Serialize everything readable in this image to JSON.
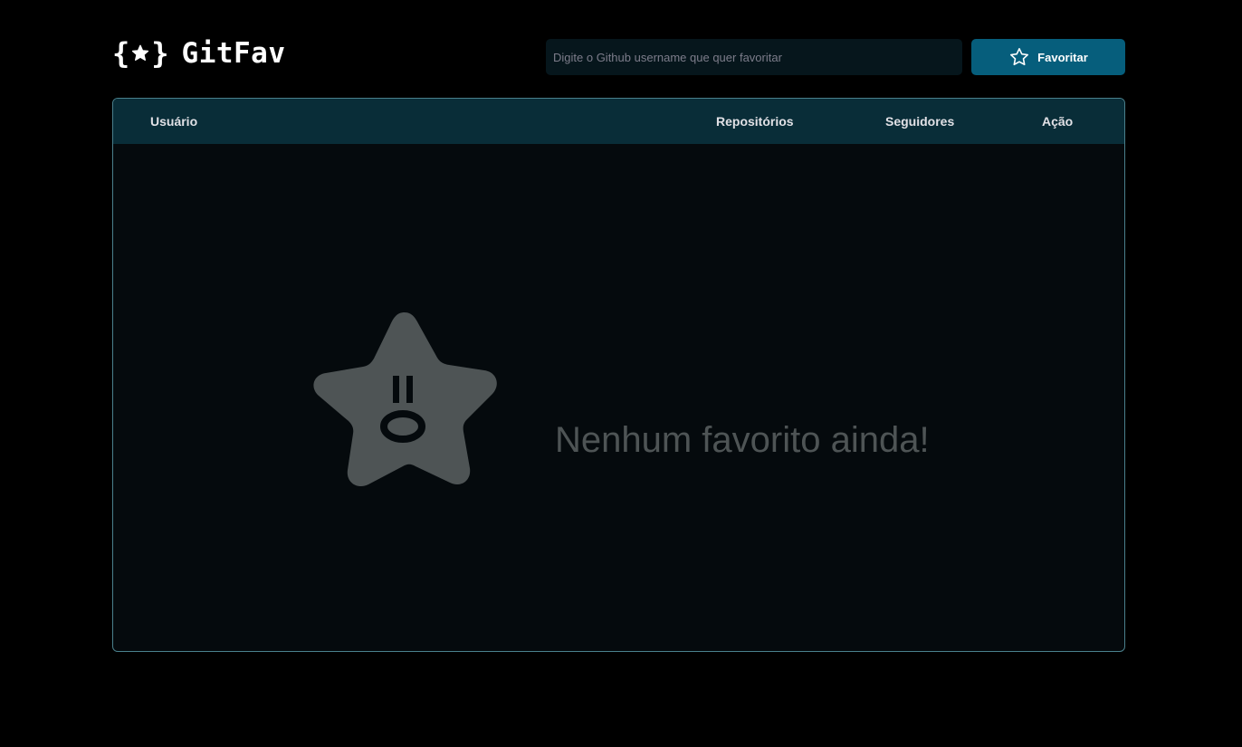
{
  "app": {
    "logo_text": "GitFav",
    "logo_icon": "star-in-braces-icon"
  },
  "search": {
    "placeholder": "Digite o Github username que quer favoritar",
    "value": ""
  },
  "favorite_button": {
    "label": "Favoritar",
    "icon": "star-outline-icon"
  },
  "table": {
    "columns": [
      "Usuário",
      "Repositórios",
      "Seguidores",
      "Ação"
    ],
    "rows": []
  },
  "empty_state": {
    "icon": "surprised-star-icon",
    "message": "Nenhum favorito ainda!"
  },
  "colors": {
    "background": "#000000",
    "header_row": "#092d38",
    "accent_button": "#065e7c",
    "table_border": "#4a808c",
    "empty_text": "#4e5455"
  }
}
